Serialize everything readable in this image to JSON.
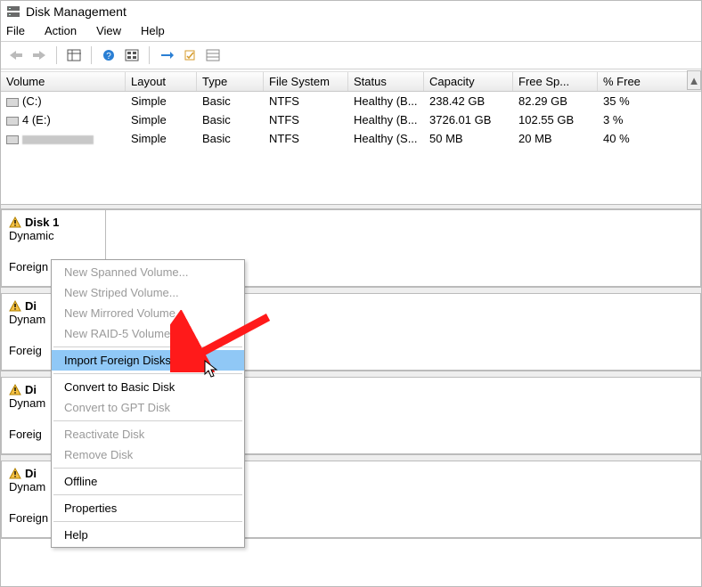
{
  "window": {
    "title": "Disk Management"
  },
  "menu": {
    "file": "File",
    "action": "Action",
    "view": "View",
    "help": "Help"
  },
  "columns": {
    "volume": "Volume",
    "layout": "Layout",
    "type": "Type",
    "fs": "File System",
    "status": "Status",
    "capacity": "Capacity",
    "free": "Free Sp...",
    "pct": "% Free"
  },
  "volumes": [
    {
      "name": "(C:)",
      "layout": "Simple",
      "type": "Basic",
      "fs": "NTFS",
      "status": "Healthy (B...",
      "capacity": "238.42 GB",
      "free": "82.29 GB",
      "pct": "35 %"
    },
    {
      "name": "4 (E:)",
      "layout": "Simple",
      "type": "Basic",
      "fs": "NTFS",
      "status": "Healthy (B...",
      "capacity": "3726.01 GB",
      "free": "102.55 GB",
      "pct": "3 %"
    },
    {
      "name": "",
      "layout": "Simple",
      "type": "Basic",
      "fs": "NTFS",
      "status": "Healthy (S...",
      "capacity": "50 MB",
      "free": "20 MB",
      "pct": "40 %"
    }
  ],
  "disks": [
    {
      "name": "Disk 1",
      "type": "Dynamic",
      "status": "Foreign"
    },
    {
      "name": "Di",
      "type": "Dynam",
      "status": "Foreig"
    },
    {
      "name": "Di",
      "type": "Dynam",
      "status": "Foreig"
    },
    {
      "name": "Di",
      "type": "Dynam",
      "status": "Foreign"
    }
  ],
  "context_menu": {
    "new_spanned": "New Spanned Volume...",
    "new_striped": "New Striped Volume...",
    "new_mirrored": "New Mirrored Volume...",
    "new_raid5": "New RAID-5 Volume...",
    "import_foreign": "Import Foreign Disks...",
    "convert_basic": "Convert to Basic Disk",
    "convert_gpt": "Convert to GPT Disk",
    "reactivate": "Reactivate Disk",
    "remove": "Remove Disk",
    "offline": "Offline",
    "properties": "Properties",
    "help": "Help"
  }
}
